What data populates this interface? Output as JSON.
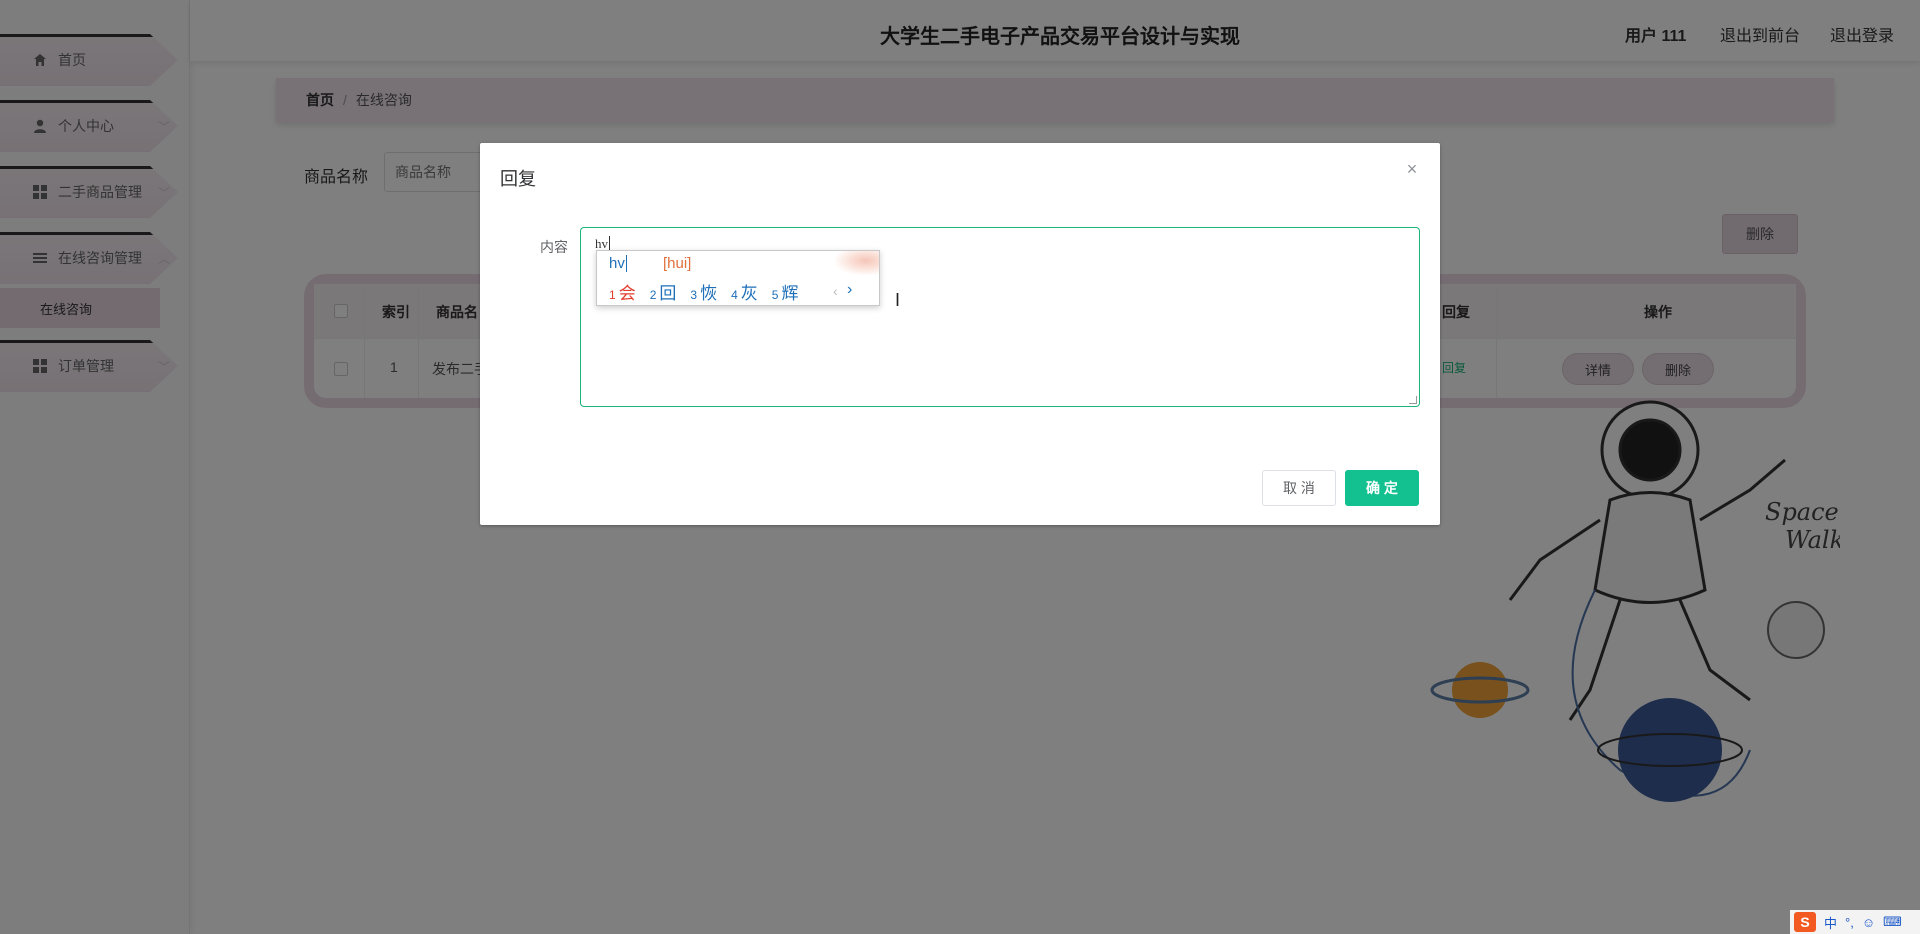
{
  "sidebar": {
    "items": [
      {
        "label": "首页",
        "icon": "home-icon"
      },
      {
        "label": "个人中心",
        "icon": "user-icon"
      },
      {
        "label": "二手商品管理",
        "icon": "grid-icon"
      },
      {
        "label": "在线咨询管理",
        "icon": "list-icon"
      },
      {
        "label": "订单管理",
        "icon": "grid-icon"
      }
    ],
    "sub_item": "在线咨询"
  },
  "header": {
    "title": "大学生二手电子产品交易平台设计与实现",
    "user": "用户 111",
    "front_link": "退出到前台",
    "logout_link": "退出登录"
  },
  "breadcrumb": {
    "home": "首页",
    "separator": "/",
    "current": "在线咨询"
  },
  "search": {
    "label": "商品名称",
    "placeholder": "商品名称"
  },
  "bulk_delete": "删除",
  "table": {
    "headers": {
      "index": "索引",
      "name": "商品名",
      "reply": "回复",
      "actions": "操作"
    },
    "rows": [
      {
        "index": "1",
        "name": "发布二手",
        "reply": "回复",
        "detail": "详情",
        "delete": "删除"
      }
    ]
  },
  "dialog": {
    "title": "回复",
    "close": "×",
    "content_label": "内容",
    "typed_text": "hv",
    "cancel": "取 消",
    "confirm": "确 定"
  },
  "ime": {
    "composition": "hv",
    "pinyin": "[hui]",
    "candidates": [
      {
        "num": "1",
        "char": "会"
      },
      {
        "num": "2",
        "char": "回"
      },
      {
        "num": "3",
        "char": "恢"
      },
      {
        "num": "4",
        "char": "灰"
      },
      {
        "num": "5",
        "char": "辉"
      }
    ],
    "prev": "‹",
    "next": "›"
  },
  "tray": {
    "logo": "S",
    "mode": "中",
    "punct": "°,",
    "emoji": "☺",
    "keyboard": "⌨"
  },
  "colors": {
    "accent": "#13c08f",
    "menu_bg": "#efe3ea",
    "ime_blue": "#1e6fb8",
    "ime_red": "#e23c2d"
  }
}
